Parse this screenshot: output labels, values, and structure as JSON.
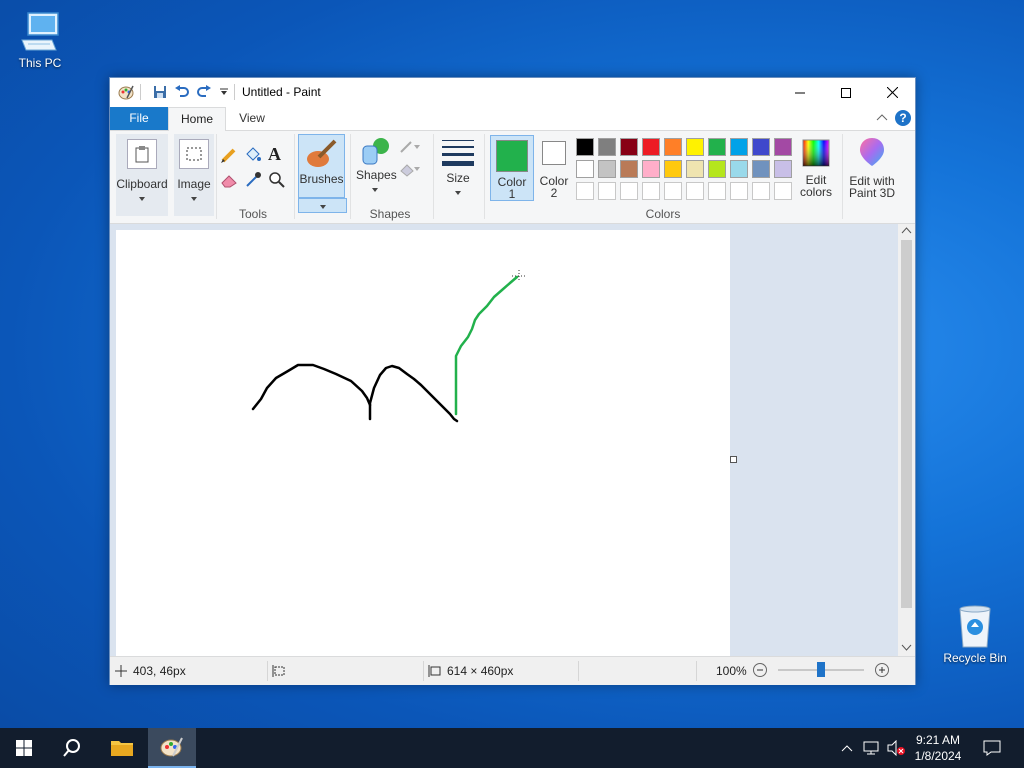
{
  "desktop": {
    "icons": [
      {
        "label": "This PC",
        "icon": "computer-icon"
      },
      {
        "label": "Recycle Bin",
        "icon": "recycle-bin-icon"
      }
    ]
  },
  "window": {
    "title": "Untitled - Paint",
    "quick_access": [
      "save-icon",
      "undo-icon",
      "redo-icon",
      "customize-dropdown-icon"
    ],
    "controls": [
      "minimize-icon",
      "maximize-icon",
      "close-icon"
    ]
  },
  "tabs": {
    "file": "File",
    "home": "Home",
    "view": "View"
  },
  "ribbon": {
    "clipboard": "Clipboard",
    "image": "Image",
    "tools": "Tools",
    "brushes": "Brushes",
    "shapes": "Shapes",
    "shapes_group": "Shapes",
    "size": "Size",
    "color1_line1": "Color",
    "color1_line2": "1",
    "color2_line1": "Color",
    "color2_line2": "2",
    "colors_group": "Colors",
    "edit_colors_line1": "Edit",
    "edit_colors_line2": "colors",
    "paint3d_line1": "Edit with",
    "paint3d_line2": "Paint 3D",
    "color1": "#22b14c",
    "color2": "#ffffff",
    "palette_row1": [
      "#000000",
      "#7f7f7f",
      "#880015",
      "#ed1c24",
      "#ff7f27",
      "#fff200",
      "#22b14c",
      "#00a2e8",
      "#3f48cc",
      "#a349a4"
    ],
    "palette_row2": [
      "#ffffff",
      "#c3c3c3",
      "#b97a57",
      "#ffaec9",
      "#ffc90e",
      "#efe4b0",
      "#b5e61d",
      "#99d9ea",
      "#7092be",
      "#c8bfe7"
    ]
  },
  "status": {
    "cursor_pos": "403, 46px",
    "image_size": "614 × 460px",
    "zoom": "100%"
  },
  "taskbar": {
    "time": "9:21 AM",
    "date": "1/8/2024"
  }
}
